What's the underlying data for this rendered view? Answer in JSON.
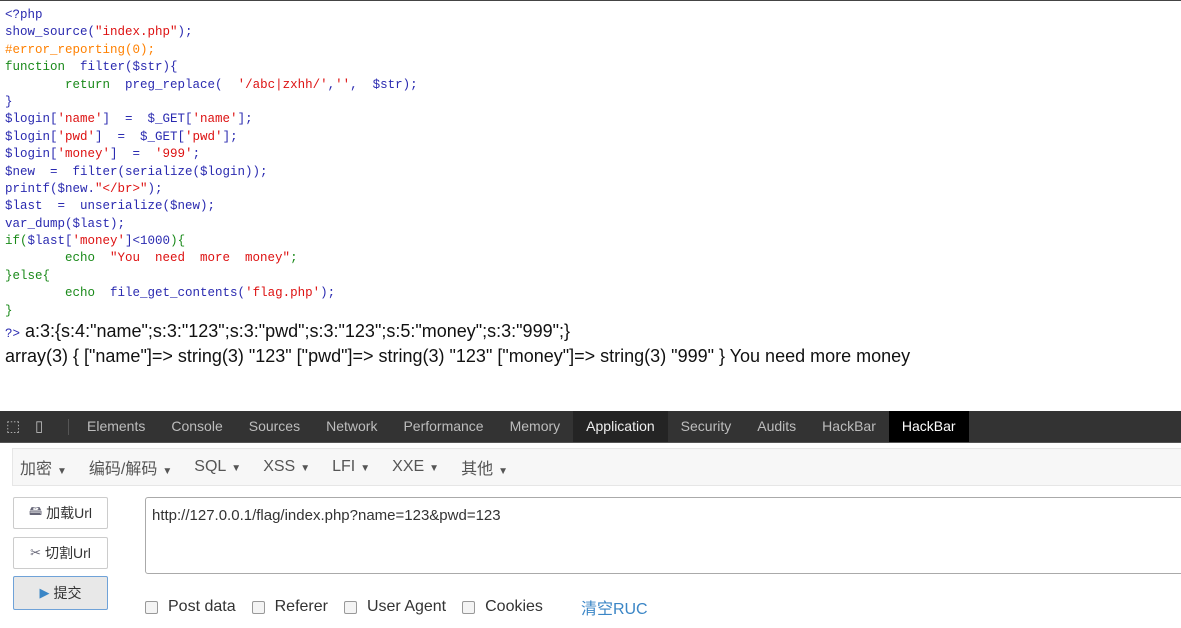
{
  "source_code": [
    [
      [
        "def",
        "<?php"
      ]
    ],
    [
      [
        "def",
        "show_source("
      ],
      [
        "str",
        "\"index.php\""
      ],
      [
        "def",
        ");"
      ]
    ],
    [
      [
        "cmt",
        "#error_reporting(0);"
      ]
    ],
    [
      [
        "kw",
        "function  "
      ],
      [
        "def",
        "filter($str){"
      ]
    ],
    [
      [
        "kw",
        "        return  "
      ],
      [
        "def",
        "preg_replace(  "
      ],
      [
        "str",
        "'/abc|zxhh/'"
      ],
      [
        "def",
        ","
      ],
      [
        "str",
        "''"
      ],
      [
        "def",
        ",  $str);"
      ]
    ],
    [
      [
        "def",
        "}"
      ]
    ],
    [
      [
        "def",
        "$login["
      ],
      [
        "str",
        "'name'"
      ],
      [
        "def",
        "]  =  $_GET["
      ],
      [
        "str",
        "'name'"
      ],
      [
        "def",
        "];"
      ]
    ],
    [
      [
        "def",
        "$login["
      ],
      [
        "str",
        "'pwd'"
      ],
      [
        "def",
        "]  =  $_GET["
      ],
      [
        "str",
        "'pwd'"
      ],
      [
        "def",
        "];"
      ]
    ],
    [
      [
        "def",
        "$login["
      ],
      [
        "str",
        "'money'"
      ],
      [
        "def",
        "]  =  "
      ],
      [
        "str",
        "'999'"
      ],
      [
        "def",
        ";"
      ]
    ],
    [
      [
        "def",
        "$new  =  filter(serialize($login));"
      ]
    ],
    [
      [
        "def",
        "printf($new."
      ],
      [
        "str",
        "\"</br>\""
      ],
      [
        "def",
        ");"
      ]
    ],
    [
      [
        "def",
        "$last  =  unserialize($new);"
      ]
    ],
    [
      [
        "def",
        "var_dump($last);"
      ]
    ],
    [
      [
        "kw",
        "if("
      ],
      [
        "def",
        "$last["
      ],
      [
        "str",
        "'money'"
      ],
      [
        "def",
        "]<1000"
      ],
      [
        "kw",
        "){"
      ]
    ],
    [
      [
        "kw",
        "        echo  "
      ],
      [
        "str",
        "\"You  need  more  money\""
      ],
      [
        "kw",
        ";"
      ]
    ],
    [
      [
        "kw",
        "}else{"
      ]
    ],
    [
      [
        "kw",
        "        echo  "
      ],
      [
        "def",
        "file_get_contents("
      ],
      [
        "str",
        "'flag.php'"
      ],
      [
        "def",
        ");"
      ]
    ],
    [
      [
        "kw",
        "}"
      ]
    ]
  ],
  "output": {
    "php_close_tag": "?>",
    "serialized": " a:3:{s:4:\"name\";s:3:\"123\";s:3:\"pwd\";s:3:\"123\";s:5:\"money\";s:3:\"999\";}",
    "var_dump_line": "array(3) { [\"name\"]=> string(3) \"123\" [\"pwd\"]=> string(3) \"123\" [\"money\"]=> string(3) \"999\" } You need more money"
  },
  "devtools": {
    "tabs": [
      "Elements",
      "Console",
      "Sources",
      "Network",
      "Performance",
      "Memory",
      "Application",
      "Security",
      "Audits",
      "HackBar",
      "HackBar"
    ],
    "active_tab_index": 10
  },
  "hackbar": {
    "menus": [
      "加密",
      "编码/解码",
      "SQL",
      "XSS",
      "LFI",
      "XXE",
      "其他"
    ],
    "load_url": "加载Url",
    "split_url": "切割Url",
    "submit": "提交",
    "url_value": "http://127.0.0.1/flag/index.php?name=123&pwd=123",
    "options": [
      "Post data",
      "Referer",
      "User Agent",
      "Cookies"
    ],
    "clear_label": "清空RUC",
    "link_color": "#3b86c6"
  }
}
